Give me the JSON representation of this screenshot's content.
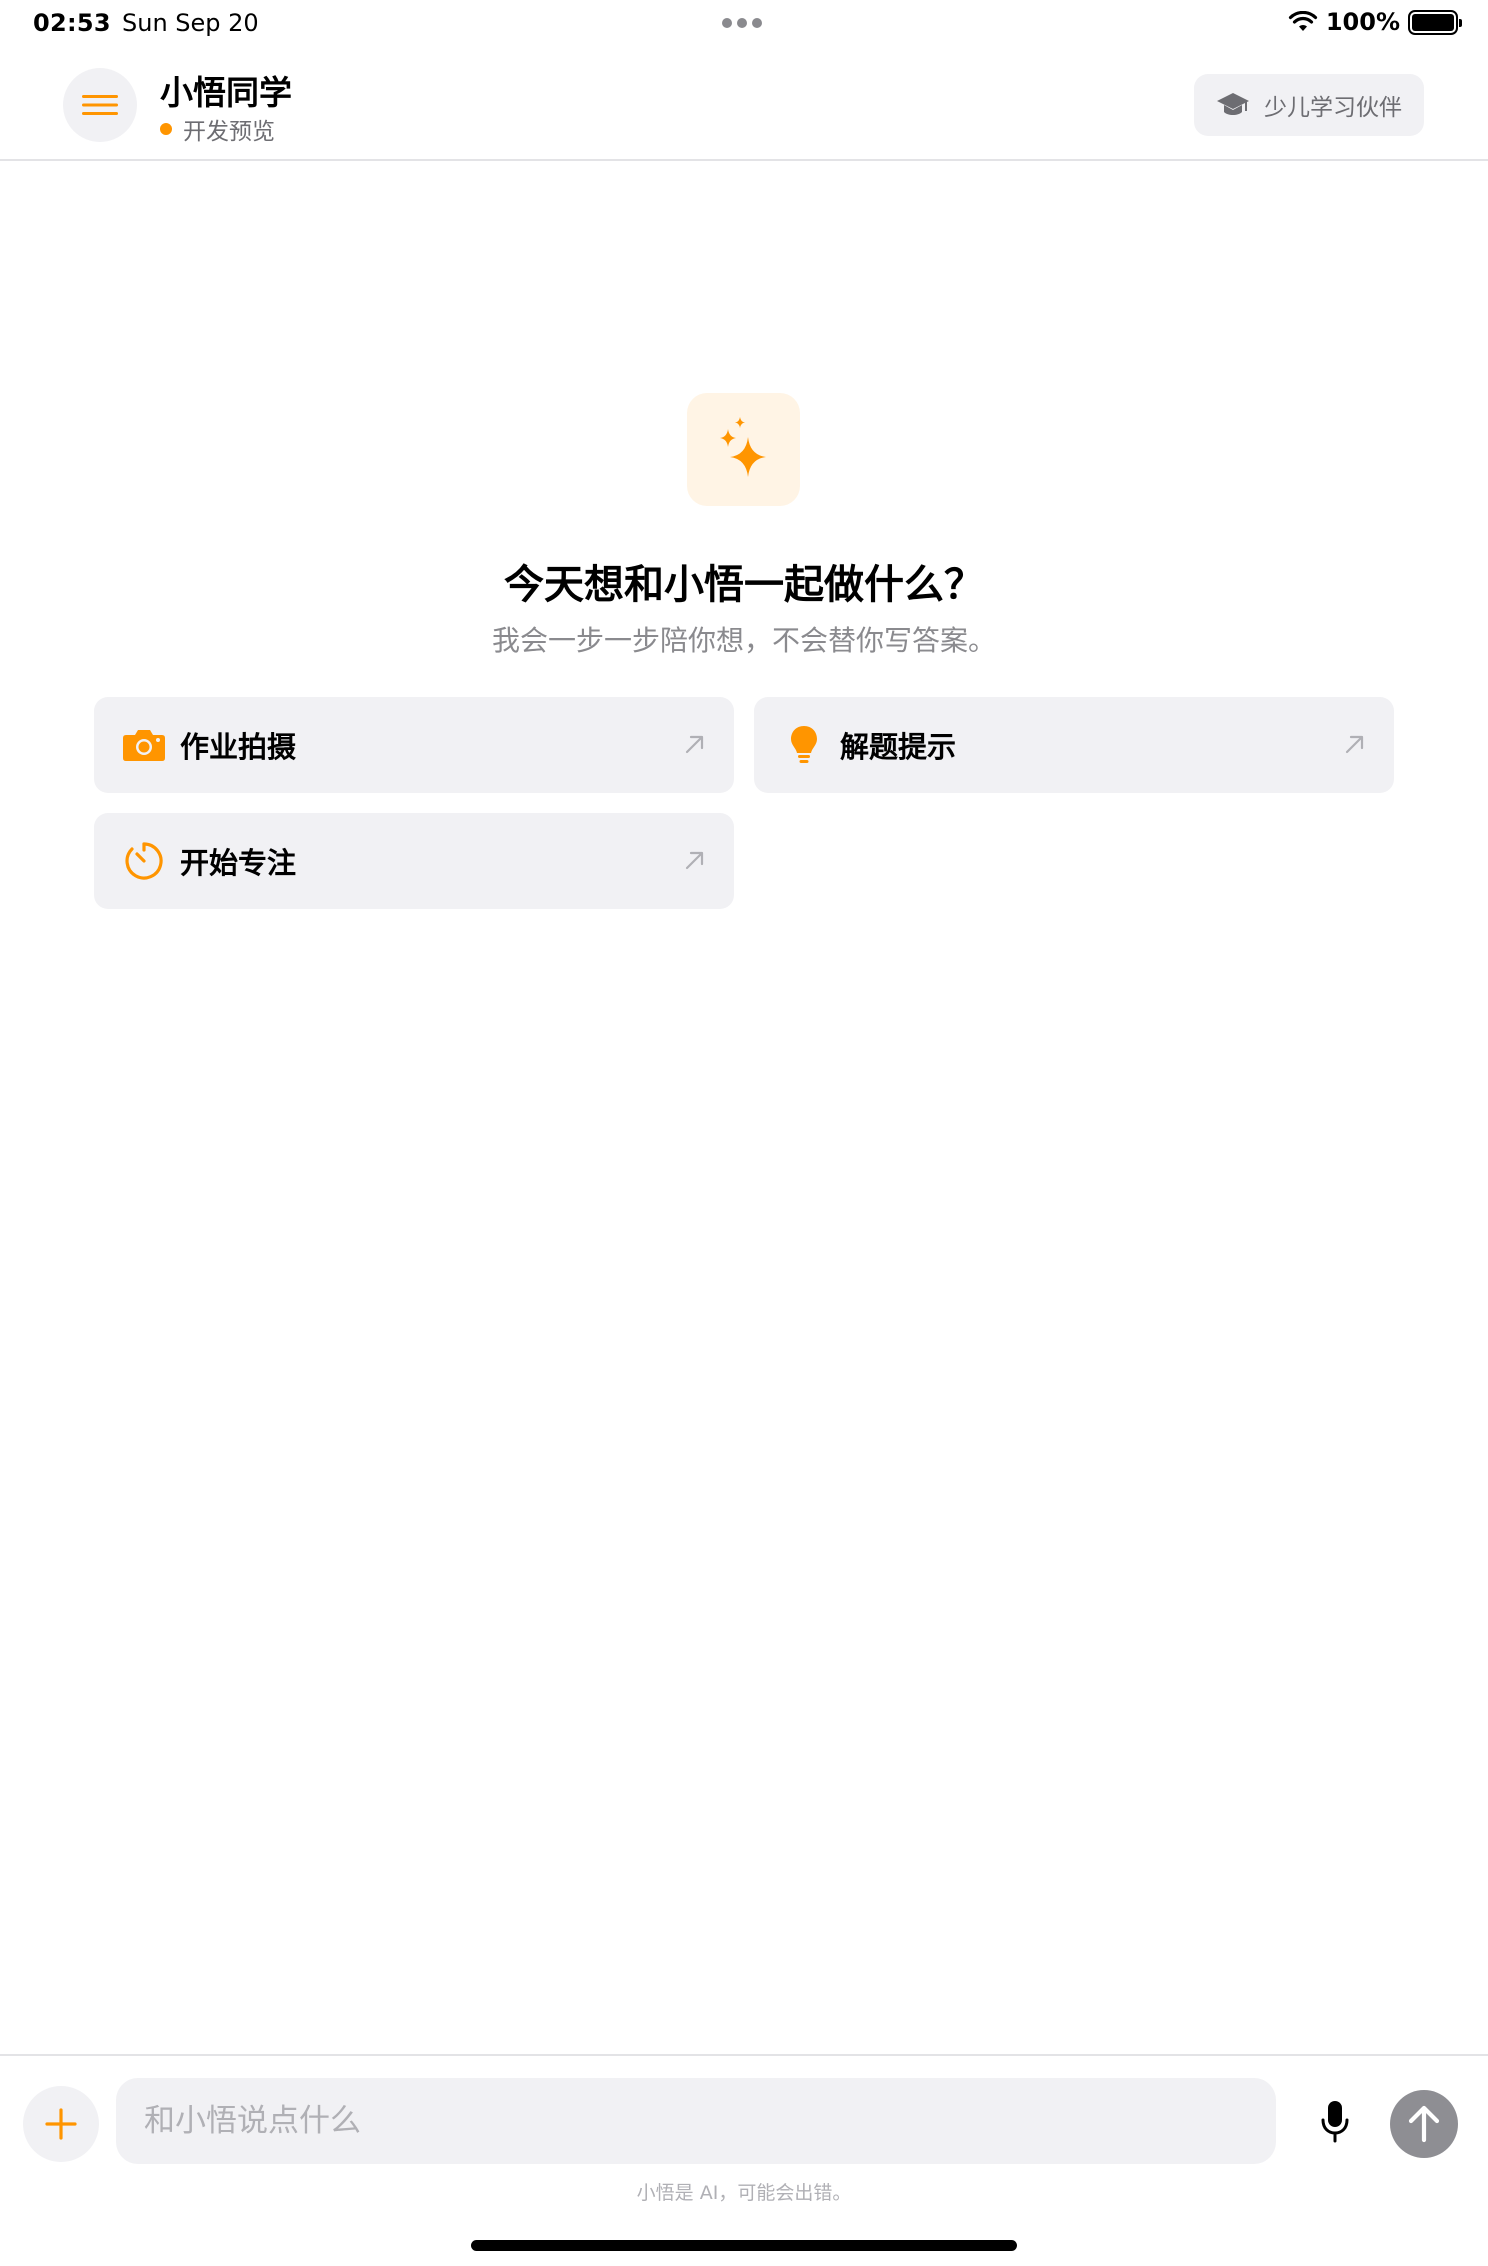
{
  "status_bar": {
    "time": "02:53",
    "date": "Sun Sep 20",
    "battery": "100%",
    "icons": [
      "multitask-dots-icon",
      "wifi-icon",
      "battery-icon"
    ]
  },
  "header": {
    "menu_icon": "hamburger-menu-icon",
    "title": "小悟同学",
    "subtitle": "开发预览",
    "mode_chip": {
      "icon": "graduation-cap-icon",
      "label": "少儿学习伙伴"
    }
  },
  "hero": {
    "icon": "sparkles-icon",
    "title": "今天想和小悟一起做什么？",
    "subtitle": "我会一步一步陪你想，不会替你写答案。"
  },
  "actions": [
    {
      "icon": "camera-icon",
      "label": "作业拍摄"
    },
    {
      "icon": "lightbulb-icon",
      "label": "解题提示"
    },
    {
      "icon": "timer-icon",
      "label": "开始专注"
    }
  ],
  "composer": {
    "placeholder": "和小悟说点什么",
    "value": "",
    "disclaimer": "小悟是 AI，可能会出错。",
    "icons": [
      "plus-icon",
      "microphone-icon",
      "arrow-up-icon"
    ]
  },
  "colors": {
    "accent": "#ff9500",
    "surface": "#f1f1f4",
    "secondary_text": "#8a8a8e",
    "send_button": "#8e8e93"
  }
}
